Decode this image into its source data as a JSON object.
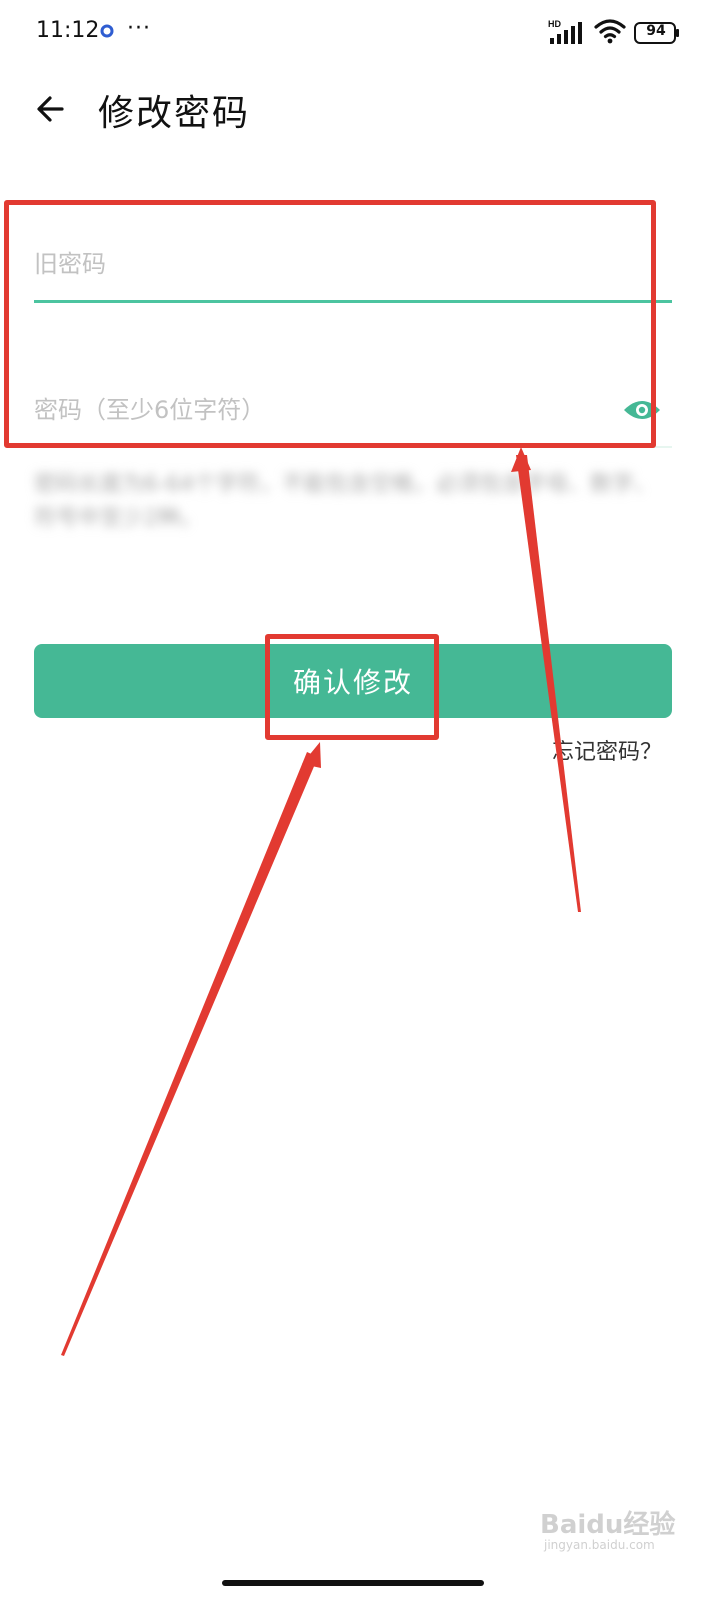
{
  "status_bar": {
    "time": "11:12",
    "more": "···",
    "network_label": "HD",
    "battery_level": "94",
    "app_dot_color": "#2f5dd1"
  },
  "header": {
    "back_icon": "arrow-left-icon",
    "title": "修改密码"
  },
  "form": {
    "old_password": {
      "placeholder": "旧密码",
      "value": "",
      "underline_color": "#4cc4a0"
    },
    "new_password": {
      "placeholder": "密码（至少6位字符）",
      "value": "",
      "toggle_icon": "eye-icon"
    },
    "hint": "密码长度为6-64个字符，不能包含空格，必须包含字母、数字、符号中至少2种。",
    "submit_label": "确认修改",
    "forgot_label": "忘记密码？"
  },
  "colors": {
    "accent": "#45b895",
    "annotation": "#e23a31"
  },
  "watermark": {
    "text": "Baidu经验",
    "sub": "jingyan.baidu.com"
  }
}
